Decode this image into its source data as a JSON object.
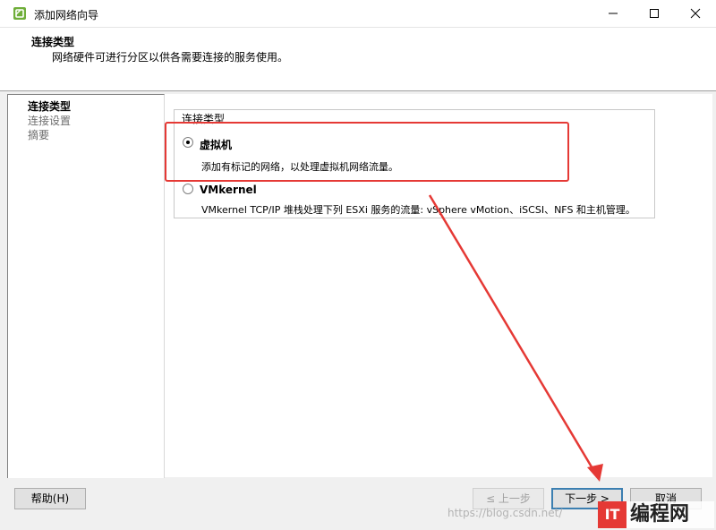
{
  "window": {
    "title": "添加网络向导",
    "icon": "vsphere-app-icon"
  },
  "header": {
    "title": "连接类型",
    "subtitle": "网络硬件可进行分区以供各需要连接的服务使用。"
  },
  "steps": [
    {
      "label": "连接类型",
      "active": true
    },
    {
      "label": "连接设置",
      "active": false
    },
    {
      "label": "摘要",
      "active": false
    }
  ],
  "connection_group": {
    "legend": "连接类型",
    "options": [
      {
        "label": "虚拟机",
        "description": "添加有标记的网络，以处理虚拟机网络流量。",
        "selected": true
      },
      {
        "label": "VMkernel",
        "description": "VMkernel TCP/IP 堆栈处理下列 ESXi 服务的流量: vSphere vMotion、iSCSI、NFS 和主机管理。",
        "selected": false
      }
    ]
  },
  "buttons": {
    "help": "帮助(H)",
    "back": "≤ 上一步",
    "next": "下一步 >",
    "cancel": "取消"
  },
  "watermark": {
    "url": "https://blog.csdn.net/",
    "logo_text": "编程网"
  },
  "colors": {
    "annotation_red": "#e53935",
    "default_button_border": "#3c7fb1"
  }
}
